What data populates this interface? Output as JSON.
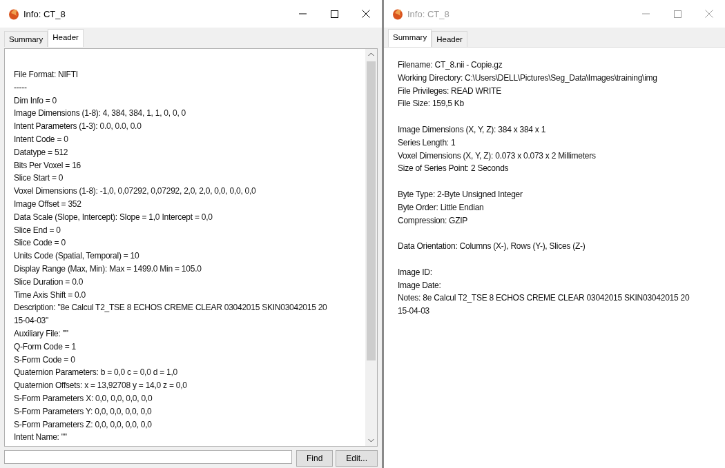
{
  "windows": [
    {
      "kind": "header",
      "title": "Info: CT_8",
      "active": true,
      "tabs": [
        {
          "label": "Summary",
          "selected": false
        },
        {
          "label": "Header",
          "selected": true
        }
      ],
      "lines": [
        "File Format: NIFTI",
        "-----",
        "Dim Info = 0",
        "Image Dimensions (1-8): 4, 384, 384, 1, 1, 0, 0, 0",
        "Intent Parameters (1-3): 0.0, 0.0, 0.0",
        "Intent Code = 0",
        "Datatype = 512",
        "Bits Per Voxel = 16",
        "Slice Start = 0",
        "Voxel Dimensions (1-8): -1,0, 0,07292, 0,07292, 2,0, 2,0, 0,0, 0,0, 0,0",
        "Image Offset = 352",
        "Data Scale (Slope, Intercept):  Slope = 1,0  Intercept = 0,0",
        "Slice End = 0",
        "Slice Code = 0",
        "Units Code (Spatial, Temporal) = 10",
        "Display Range (Max, Min):  Max = 1499.0  Min = 105.0",
        "Slice Duration = 0.0",
        "Time Axis Shift = 0.0",
        "Description: \"8e Calcul T2_TSE 8 ECHOS CREME CLEAR 03042015 SKIN03042015 20",
        "15-04-03\"",
        "Auxiliary File: \"\"",
        "Q-Form Code = 1",
        "S-Form Code = 0",
        "Quaternion Parameters:  b = 0,0  c = 0,0  d = 1,0",
        "Quaternion Offsets:  x = 13,92708  y = 14,0  z = 0,0",
        "S-Form Parameters X: 0,0, 0,0, 0,0, 0,0",
        "S-Form Parameters Y: 0,0, 0,0, 0,0, 0,0",
        "S-Form Parameters Z: 0,0, 0,0, 0,0, 0,0",
        "Intent Name: \"\""
      ],
      "buttons": [
        "Find",
        "Edit..."
      ]
    },
    {
      "kind": "summary",
      "title": "Info: CT_8",
      "active": false,
      "tabs": [
        {
          "label": "Summary",
          "selected": true
        },
        {
          "label": "Header",
          "selected": false
        }
      ],
      "groups": [
        [
          "Filename: CT_8.nii - Copie.gz",
          "Working Directory: C:\\Users\\DELL\\Pictures\\Seg_Data\\Images\\training\\img",
          "File Privileges: READ WRITE",
          "File Size: 159,5 Kb"
        ],
        [
          "Image Dimensions (X, Y, Z): 384 x 384 x 1",
          "Series Length: 1",
          "Voxel Dimensions (X, Y, Z): 0.073 x 0.073 x 2 Millimeters",
          "Size of Series Point: 2 Seconds"
        ],
        [
          "Byte Type: 2-Byte Unsigned Integer",
          "Byte Order: Little Endian",
          "Compression: GZIP"
        ],
        [
          "Data Orientation: Columns (X-), Rows (Y-), Slices (Z-)"
        ],
        [
          "Image ID:",
          "Image Date:",
          "Notes:  8e Calcul T2_TSE 8 ECHOS CREME CLEAR 03042015 SKIN03042015 20",
          "15-04-03"
        ]
      ]
    }
  ]
}
